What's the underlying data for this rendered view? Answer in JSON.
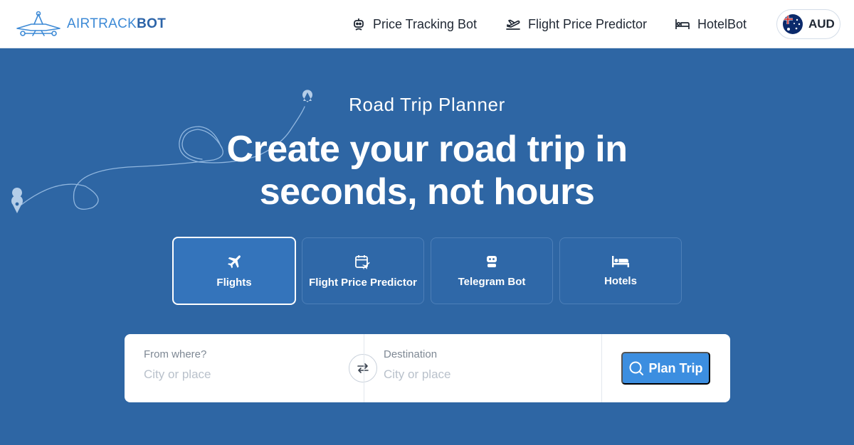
{
  "brand": {
    "name_light": "AIRTRACK",
    "name_bold": "BOT"
  },
  "nav": {
    "price_tracking": "Price Tracking Bot",
    "flight_predictor": "Flight Price Predictor",
    "hotelbot": "HotelBot"
  },
  "currency": {
    "code": "AUD",
    "flag_icon": "australia-flag-icon"
  },
  "hero": {
    "eyebrow": "Road Trip Planner",
    "headline_line1": "Create your road trip in",
    "headline_line2": "seconds, not hours"
  },
  "tabs": [
    {
      "label": "Flights",
      "icon": "plane-icon",
      "active": true
    },
    {
      "label": "Flight Price Predictor",
      "icon": "calendar-plane-icon",
      "active": false
    },
    {
      "label": "Telegram Bot",
      "icon": "robot-icon",
      "active": false
    },
    {
      "label": "Hotels",
      "icon": "bed-icon",
      "active": false
    }
  ],
  "search": {
    "from_label": "From where?",
    "from_placeholder": "City or place",
    "from_value": "",
    "dest_label": "Destination",
    "dest_placeholder": "City or place",
    "dest_value": "",
    "submit_label": "Plan Trip"
  },
  "colors": {
    "hero_bg": "#2e66a4",
    "accent": "#3c8ee0",
    "brand_blue": "#2c64a8",
    "tab_active_border": "#ffffff"
  }
}
